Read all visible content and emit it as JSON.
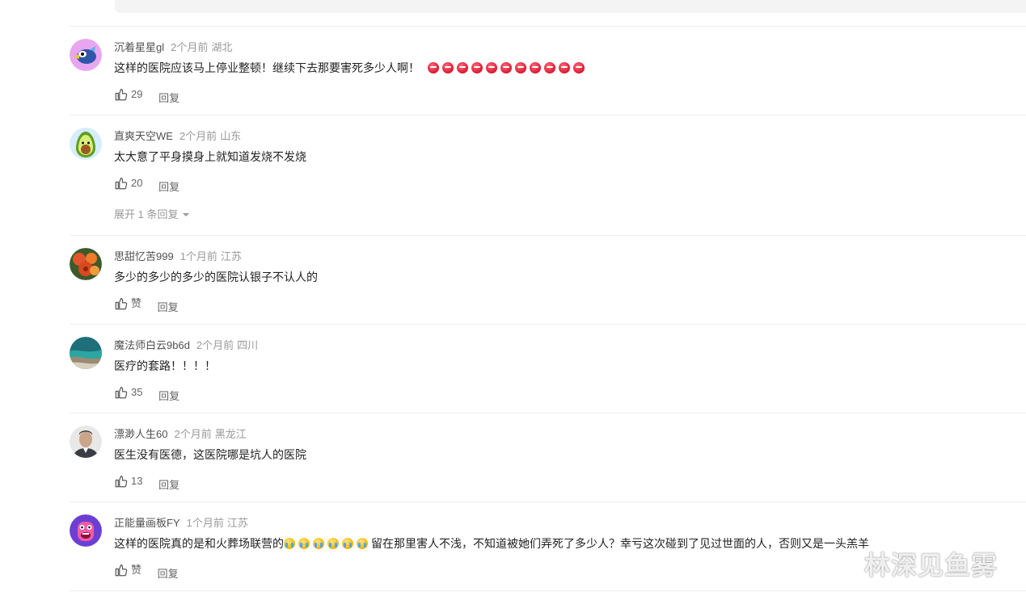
{
  "comments": [
    {
      "username": "沉着星星gl",
      "time": "2个月前",
      "location": "湖北",
      "text": "这样的医院应该马上停业整顿！继续下去那要害死多少人啊！",
      "emoji_count": 11,
      "emoji": "angry-face",
      "likes": "29",
      "reply_label": "回复"
    },
    {
      "username": "直爽天空WE",
      "time": "2个月前",
      "location": "山东",
      "text": "太大意了平身摸身上就知道发烧不发烧",
      "likes": "20",
      "reply_label": "回复",
      "expand_label": "展开 1 条回复"
    },
    {
      "username": "思甜忆苦999",
      "time": "1个月前",
      "location": "江苏",
      "text": "多少的多少的多少的医院认银子不认人的",
      "likes": "赞",
      "reply_label": "回复"
    },
    {
      "username": "魔法师白云9b6d",
      "time": "2个月前",
      "location": "四川",
      "text": "医疗的套路！！！！",
      "likes": "35",
      "reply_label": "回复"
    },
    {
      "username": "漂渺人生60",
      "time": "2个月前",
      "location": "黑龙江",
      "text": "医生没有医德，这医院哪是坑人的医院",
      "likes": "13",
      "reply_label": "回复"
    },
    {
      "username": "正能量画板FY",
      "time": "1个月前",
      "location": "江苏",
      "text_before": "这样的医院真的是和火葬场联营的",
      "emoji_count": 6,
      "emoji": "crying-face",
      "text_after": "留在那里害人不浅，不知道被她们弄死了多少人？幸亏这次碰到了见过世面的人，否则又是一头羔羊",
      "likes": "赞",
      "reply_label": "回复"
    }
  ],
  "watermark": "林深见鱼雾",
  "icons": {
    "like": "thumbs-up-icon",
    "expand": "caret-down-icon"
  },
  "colors": {
    "username": "#505050",
    "meta": "#999999",
    "text": "#222222",
    "action": "#666666",
    "divider": "#eeeeee"
  }
}
